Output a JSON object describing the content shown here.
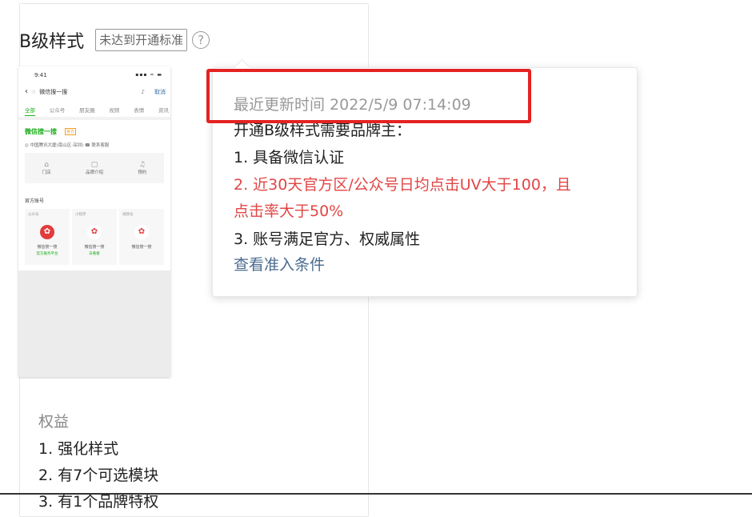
{
  "card": {
    "title": "B级样式",
    "badge": "未达到开通标准",
    "help_glyph": "?",
    "benefits_title": "权益",
    "benefits": [
      "1. 强化样式",
      "2. 有7个可选模块",
      "3. 有1个品牌特权"
    ]
  },
  "phone_preview": {
    "time": "9:41",
    "signal": "▪▪▪ ≈ ▬",
    "search_text": "微信搜一搜",
    "cancel": "取消",
    "tabs": [
      "全部",
      "公众号",
      "朋友圈",
      "视频",
      "表情",
      "资讯"
    ],
    "brand_name": "微信搜一搜",
    "brand_tag": "官方",
    "address": "◎ 中国腾讯大厦(南山区·深圳)   ☎ 联系客服",
    "services": [
      {
        "icon": "⌂",
        "label": "门店"
      },
      {
        "icon": "▢",
        "label": "品牌介绍"
      },
      {
        "icon": "♫",
        "label": "预约"
      }
    ],
    "official_title": "官方账号",
    "accounts": [
      {
        "label": "公众号",
        "name": "微信搜一搜",
        "sub": "官方服务平台"
      },
      {
        "label": "小程序",
        "name": "微信搜一搜",
        "sub": "去看看"
      },
      {
        "label": "视频号",
        "name": "微信搜一搜",
        "sub": ""
      }
    ]
  },
  "tooltip": {
    "updated": "最近更新时间 2022/5/9 07:14:09",
    "intro": "开通B级样式需要品牌主：",
    "req1": "1. 具备微信认证",
    "req2_line1": "2. 近30天官方区/公众号日均点击UV大于100，且",
    "req2_line2": "点击率大于50%",
    "req3": "3. 账号满足官方、权威属性",
    "link": "查看准入条件"
  },
  "colors": {
    "brand_green": "#1aad19",
    "warning_red": "#e24545",
    "link": "#4a6b8f",
    "highlight": "#e52222"
  }
}
